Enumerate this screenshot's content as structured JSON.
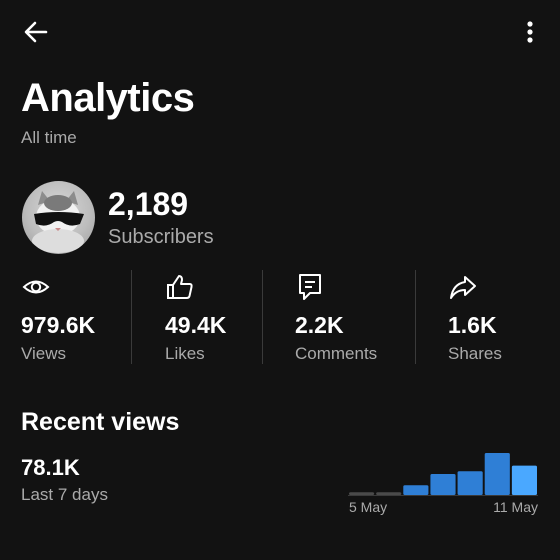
{
  "header": {
    "title": "Analytics",
    "subtitle": "All time",
    "icons": {
      "back": "arrow-left-icon",
      "more": "more-vertical-icon"
    }
  },
  "channel": {
    "avatar": "cat-with-sunglasses",
    "subscriber_count": "2,189",
    "subscriber_label": "Subscribers"
  },
  "stats": [
    {
      "icon": "eye-icon",
      "value": "979.6K",
      "label": "Views"
    },
    {
      "icon": "thumbs-up-icon",
      "value": "49.4K",
      "label": "Likes"
    },
    {
      "icon": "comment-icon",
      "value": "2.2K",
      "label": "Comments"
    },
    {
      "icon": "share-icon",
      "value": "1.6K",
      "label": "Shares"
    }
  ],
  "recent": {
    "title": "Recent views",
    "value": "78.1K",
    "period": "Last 7 days"
  },
  "chart_data": {
    "type": "bar",
    "categories": [
      "5 May",
      "6 May",
      "7 May",
      "8 May",
      "9 May",
      "10 May",
      "11 May"
    ],
    "values": [
      1.0,
      1.0,
      3.5,
      7.5,
      8.5,
      15.0,
      10.5
    ],
    "x_tick_labels": [
      "5 May",
      "11 May"
    ],
    "title": "",
    "xlabel": "",
    "ylabel": "",
    "ylim": [
      0,
      15
    ],
    "grid": false,
    "colors": {
      "low": "#4a4a4a",
      "bar": "#2f7fd6",
      "highlight": "#4aa8ff",
      "axis": "#3a3a3a"
    }
  }
}
